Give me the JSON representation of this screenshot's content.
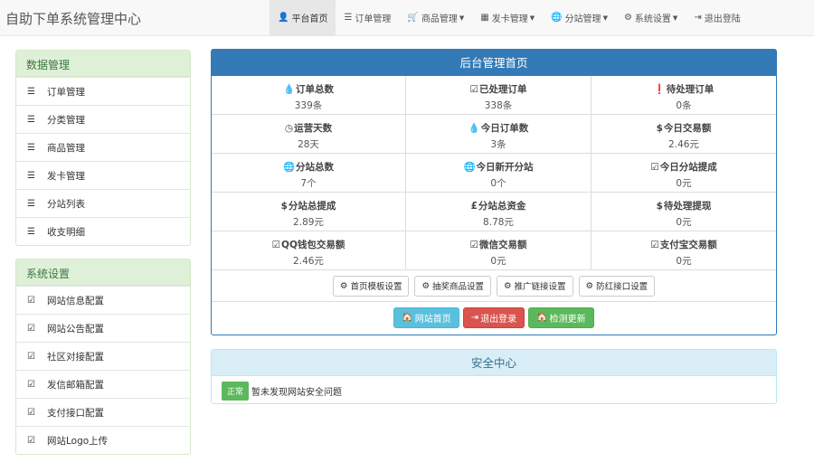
{
  "app": {
    "title": "自助下单系统管理中心"
  },
  "nav": [
    {
      "icon": "👤",
      "label": "平台首页",
      "active": true,
      "dropdown": false
    },
    {
      "icon": "☰",
      "label": "订单管理",
      "active": false,
      "dropdown": false
    },
    {
      "icon": "🛒",
      "label": "商品管理",
      "active": false,
      "dropdown": true
    },
    {
      "icon": "▦",
      "label": "发卡管理",
      "active": false,
      "dropdown": true
    },
    {
      "icon": "🌐",
      "label": "分站管理",
      "active": false,
      "dropdown": true
    },
    {
      "icon": "⚙",
      "label": "系统设置",
      "active": false,
      "dropdown": true
    },
    {
      "icon": "⇥",
      "label": "退出登陆",
      "active": false,
      "dropdown": false
    }
  ],
  "sidebar": {
    "data": {
      "title": "数据管理",
      "items": [
        {
          "icon": "☰",
          "label": "订单管理"
        },
        {
          "icon": "☰",
          "label": "分类管理"
        },
        {
          "icon": "☰",
          "label": "商品管理"
        },
        {
          "icon": "☰",
          "label": "发卡管理"
        },
        {
          "icon": "☰",
          "label": "分站列表"
        },
        {
          "icon": "☰",
          "label": "收支明细"
        }
      ]
    },
    "system": {
      "title": "系统设置",
      "items": [
        {
          "icon": "☑",
          "label": "网站信息配置"
        },
        {
          "icon": "☑",
          "label": "网站公告配置"
        },
        {
          "icon": "☑",
          "label": "社区对接配置"
        },
        {
          "icon": "☑",
          "label": "发信邮箱配置"
        },
        {
          "icon": "☑",
          "label": "支付接口配置"
        },
        {
          "icon": "☑",
          "label": "网站Logo上传"
        }
      ]
    }
  },
  "main": {
    "title": "后台管理首页",
    "stats": [
      {
        "icon": "💧",
        "label": "订单总数",
        "value": "339条"
      },
      {
        "icon": "☑",
        "label": "已处理订单",
        "value": "338条"
      },
      {
        "icon": "❗",
        "label": "待处理订单",
        "value": "0条"
      },
      {
        "icon": "◷",
        "label": "运营天数",
        "value": "28天"
      },
      {
        "icon": "💧",
        "label": "今日订单数",
        "value": "3条"
      },
      {
        "icon": "$",
        "label": "今日交易额",
        "value": "2.46元"
      },
      {
        "icon": "🌐",
        "label": "分站总数",
        "value": "7个"
      },
      {
        "icon": "🌐",
        "label": "今日新开分站",
        "value": "0个"
      },
      {
        "icon": "☑",
        "label": "今日分站提成",
        "value": "0元"
      },
      {
        "icon": "$",
        "label": "分站总提成",
        "value": "2.89元"
      },
      {
        "icon": "£",
        "label": "分站总资金",
        "value": "8.78元"
      },
      {
        "icon": "$",
        "label": "待处理提现",
        "value": "0元"
      },
      {
        "icon": "☑",
        "label": "QQ钱包交易额",
        "value": "2.46元"
      },
      {
        "icon": "☑",
        "label": "微信交易额",
        "value": "0元"
      },
      {
        "icon": "☑",
        "label": "支付宝交易额",
        "value": "0元"
      }
    ],
    "settings_buttons": [
      {
        "icon": "⚙",
        "label": "首页模板设置"
      },
      {
        "icon": "⚙",
        "label": "抽奖商品设置"
      },
      {
        "icon": "⚙",
        "label": "推广链接设置"
      },
      {
        "icon": "⚙",
        "label": "防红接口设置"
      }
    ],
    "actions": [
      {
        "icon": "🏠",
        "label": "网站首页",
        "style": "info"
      },
      {
        "icon": "⇥",
        "label": "退出登录",
        "style": "danger"
      },
      {
        "icon": "🏠",
        "label": "检测更新",
        "style": "success"
      }
    ]
  },
  "security": {
    "title": "安全中心",
    "badge": "正常",
    "message": "暂未发现网站安全问题"
  },
  "colors": {
    "primary": "#337ab7",
    "success_panel": "#dff0d8",
    "info_panel": "#d9edf7",
    "btn_info": "#5bc0de",
    "btn_danger": "#d9534f",
    "btn_success": "#5cb85c"
  }
}
